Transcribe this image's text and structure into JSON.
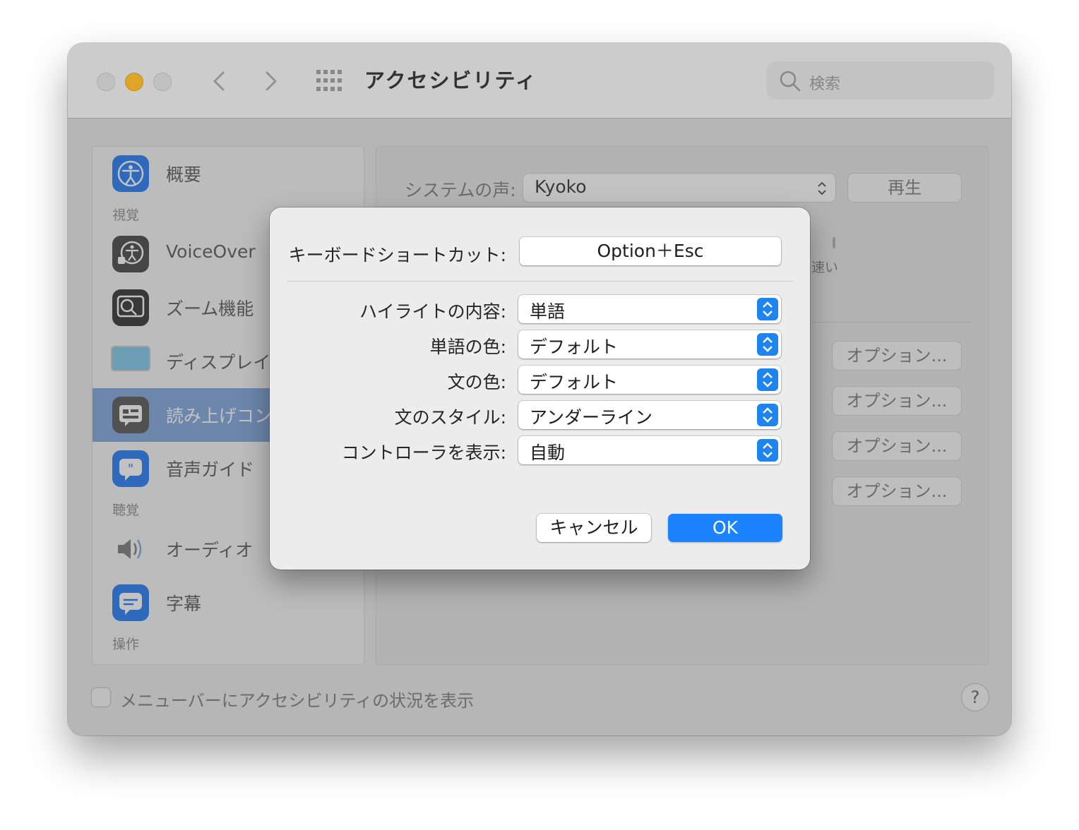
{
  "window": {
    "title": "アクセシビリティ",
    "search_placeholder": "検索"
  },
  "sidebar": {
    "items": [
      {
        "label": "概要",
        "icon": "accessibility-icon"
      },
      {
        "label": "VoiceOver",
        "icon": "voiceover-icon"
      },
      {
        "label": "ズーム機能",
        "icon": "zoom-icon"
      },
      {
        "label": "ディスプレイ",
        "icon": "display-icon"
      },
      {
        "label": "読み上げコン",
        "icon": "spoken-content-icon"
      },
      {
        "label": "音声ガイド",
        "icon": "descriptions-icon"
      },
      {
        "label": "オーディオ",
        "icon": "audio-icon"
      },
      {
        "label": "字幕",
        "icon": "captions-icon"
      }
    ],
    "sections": {
      "vision": "視覚",
      "hearing": "聴覚",
      "motor": "操作"
    }
  },
  "content": {
    "system_voice_label": "システムの声:",
    "system_voice_value": "Kyoko",
    "play_label": "再生",
    "speed_label": "速い",
    "options_label": "オプション..."
  },
  "footer": {
    "checkbox_label": "メニューバーにアクセシビリティの状況を表示",
    "help": "?"
  },
  "dialog": {
    "shortcut_label": "キーボードショートカット:",
    "shortcut_value": "Option＋Esc",
    "rows": [
      {
        "label": "ハイライトの内容:",
        "value": "単語"
      },
      {
        "label": "単語の色:",
        "value": "デフォルト"
      },
      {
        "label": "文の色:",
        "value": "デフォルト"
      },
      {
        "label": "文のスタイル:",
        "value": "アンダーライン"
      },
      {
        "label": "コントローラを表示:",
        "value": "自動"
      }
    ],
    "cancel_label": "キャンセル",
    "ok_label": "OK"
  },
  "colors": {
    "accent": "#1b83ff",
    "selection": "#8fb0e3",
    "minimize": "#fdbc2e"
  }
}
